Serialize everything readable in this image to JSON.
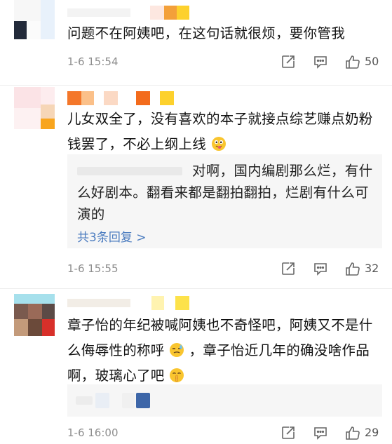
{
  "comments": [
    {
      "text": "问题不在阿姨吧，在这句话就很烦，要你管我",
      "time": "1-6 15:54",
      "likes": "50"
    },
    {
      "text_before_emoji": "儿女双全了，没有喜欢的本子就接点综艺赚点奶粉钱罢了，不必上纲上线",
      "emoji": "face-with-tongue-emoji",
      "reply": {
        "text": "对啊，国内编剧那么烂，有什么好剧本。翻看来都是翻拍翻拍，烂剧有什么可演的",
        "more": "共3条回复 >"
      },
      "time": "1-6 15:55",
      "likes": "32"
    },
    {
      "text_part1": "章子怡的年纪被喊阿姨也不奇怪吧，阿姨又不是什么侮辱性的称呼",
      "emoji1": "sweat-face-emoji",
      "text_part2": "，章子怡近几年的确没啥作品啊，玻璃心了吧",
      "emoji2": "shushing-face-emoji",
      "time": "1-6 16:00",
      "likes": "29"
    }
  ],
  "icons": {
    "share": "share-icon",
    "comment": "comment-icon",
    "like": "thumbs-up-icon"
  },
  "colors": {
    "time_gray": "#8e8e8e",
    "link_blue": "#4a7bbf",
    "reply_bg": "#f6f6f6"
  }
}
